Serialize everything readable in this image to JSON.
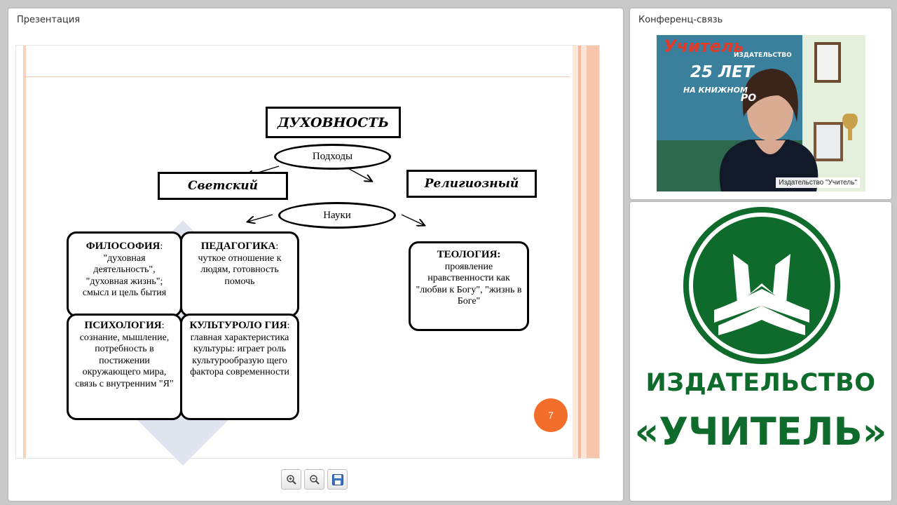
{
  "presentation": {
    "title": "Презентация",
    "page_number": "7",
    "toolbar": {
      "zoom_in": "zoom-in-icon",
      "zoom_out": "zoom-out-icon",
      "save": "save-icon"
    },
    "diagram": {
      "main": "ДУХОВНОСТЬ",
      "approaches": "Подходы",
      "secular": "Светский",
      "religious": "Религиозный",
      "sciences": "Науки",
      "philosophy": {
        "head": "ФИЛОСОФИЯ",
        "text": ": \"духовная деятельность\", \"духовная жизнь\"; смысл и цель бытия"
      },
      "pedagogy": {
        "head": "ПЕДАГОГИКА",
        "text": ": чуткое отношение к людям, готовность помочь"
      },
      "psychology": {
        "head": "ПСИХОЛОГИЯ",
        "text": ": сознание, мышление, потребность в постижении окружающего мира, связь с внутренним \"Я\""
      },
      "culturology": {
        "head": "КУЛЬТУРОЛО ГИЯ",
        "text": ": главная характеристика культуры: играет роль культурообразую щего фактора современности"
      },
      "theology": {
        "head": "ТЕОЛОГИЯ:",
        "text": "проявление нравственности как \"любви к Богу\", \"жизнь в Боге\""
      }
    }
  },
  "conference": {
    "title": "Конференц-связь",
    "participant": "Издательство \"Учитель\"",
    "banner_top": "Учитель",
    "banner_sub": "ИЗДАТЕЛЬСТВО",
    "banner_25": "25 ЛЕТ",
    "banner_line": "НА КНИЖНОМ",
    "banner_ro": "РО"
  },
  "logo": {
    "line1": "ИЗДАТЕЛЬСТВО",
    "line2": "«УЧИТЕЛЬ»",
    "color": "#0f6b2b"
  }
}
